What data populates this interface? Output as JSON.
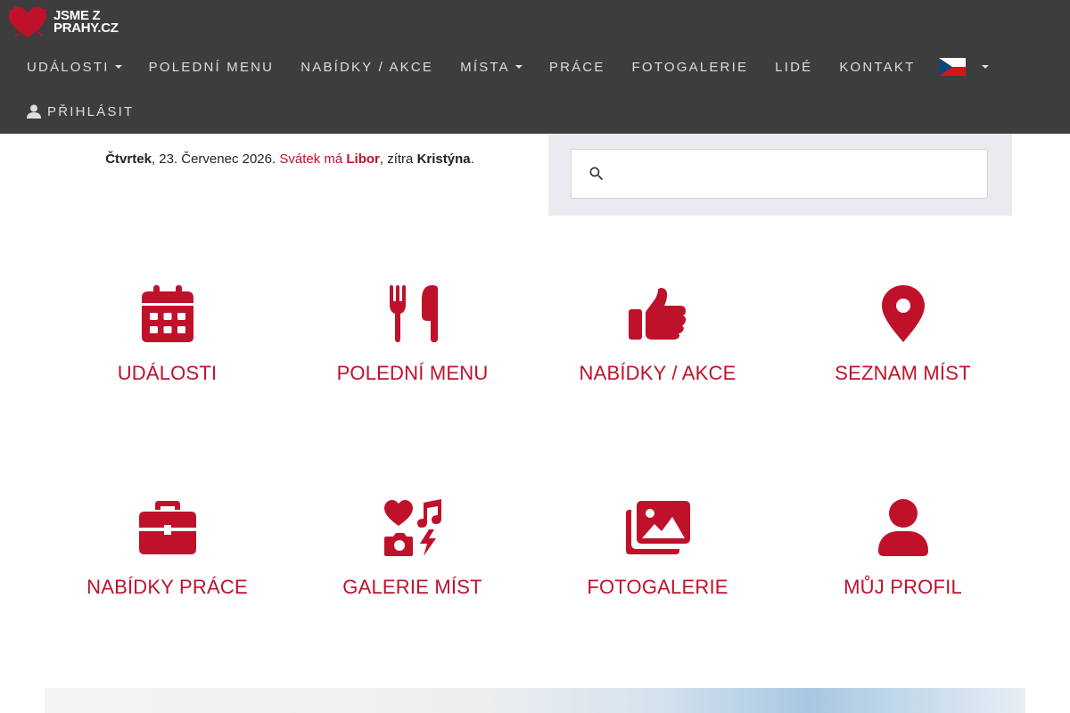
{
  "brand": {
    "logo_line1": "JSME Z",
    "logo_line2": "PRAHY.CZ",
    "accent_color": "#c0112b",
    "navbar_color": "#3d3d3d"
  },
  "nav": {
    "items": [
      {
        "label": "UDÁLOSTI",
        "dropdown": true
      },
      {
        "label": "POLEDNÍ MENU",
        "dropdown": false
      },
      {
        "label": "NABÍDKY / AKCE",
        "dropdown": false
      },
      {
        "label": "MÍSTA",
        "dropdown": true
      },
      {
        "label": "PRÁCE",
        "dropdown": false
      },
      {
        "label": "FOTOGALERIE",
        "dropdown": false
      },
      {
        "label": "LIDÉ",
        "dropdown": false
      },
      {
        "label": "KONTAKT",
        "dropdown": false
      }
    ],
    "language_icon": "czech-flag-icon",
    "login_label": "PŘIHLÁSIT",
    "login_icon": "user-icon"
  },
  "date_line": {
    "day": "Čtvrtek",
    "date": ", 23. Červenec 2026. ",
    "nameday_prefix": "Svátek má ",
    "nameday_today": "Libor",
    "tomorrow_prefix": ", zítra ",
    "nameday_tomorrow": "Kristýna",
    "end": "."
  },
  "search": {
    "placeholder": "",
    "value": "",
    "icon": "search-icon"
  },
  "tiles": [
    {
      "label": "UDÁLOSTI",
      "icon": "calendar-icon"
    },
    {
      "label": "POLEDNÍ MENU",
      "icon": "fork-knife-icon"
    },
    {
      "label": "NABÍDKY / AKCE",
      "icon": "thumbs-up-icon"
    },
    {
      "label": "SEZNAM MÍST",
      "icon": "map-pin-icon"
    },
    {
      "label": "NABÍDKY PRÁCE",
      "icon": "briefcase-icon"
    },
    {
      "label": "GALERIE MÍST",
      "icon": "icons-collage-icon"
    },
    {
      "label": "FOTOGALERIE",
      "icon": "photos-icon"
    },
    {
      "label": "MŮJ PROFIL",
      "icon": "user-icon"
    }
  ]
}
